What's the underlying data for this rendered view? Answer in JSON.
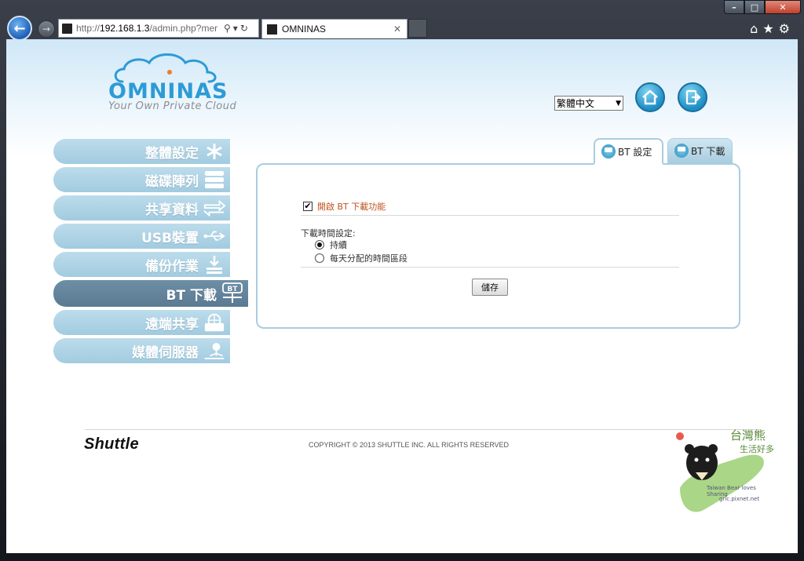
{
  "browser": {
    "url_prefix": "http://",
    "url_host": "192.168.1.3",
    "url_rest": "/admin.php?mer",
    "tab_title": "OMNINAS",
    "window_controls": [
      "minimize-icon",
      "maximize-icon",
      "close-icon"
    ]
  },
  "header": {
    "logo_text": "OMNINAS",
    "logo_sub": "Your Own Private Cloud",
    "language": "繁體中文"
  },
  "sidebar": {
    "items": [
      {
        "label": "整體設定",
        "icon": "asterisk-icon"
      },
      {
        "label": "磁碟陣列",
        "icon": "disk-stack-icon"
      },
      {
        "label": "共享資料",
        "icon": "exchange-arrows-icon"
      },
      {
        "label": "USB裝置",
        "icon": "usb-icon"
      },
      {
        "label": "備份作業",
        "icon": "download-tray-icon"
      },
      {
        "label": "BT 下載",
        "icon": "bt-download-icon",
        "badge": "BT",
        "active": true
      },
      {
        "label": "遠端共享",
        "icon": "globe-folder-icon"
      },
      {
        "label": "媒體伺服器",
        "icon": "media-server-icon"
      }
    ]
  },
  "panel": {
    "tabs": [
      {
        "label": "BT 設定",
        "active": true
      },
      {
        "label": "BT 下載",
        "active": false
      }
    ],
    "enable_label": "開啟 BT 下載功能",
    "enable_checked": true,
    "schedule_label": "下載時間設定:",
    "radio_options": [
      {
        "label": "持續",
        "selected": true
      },
      {
        "label": "每天分配的時間區段",
        "selected": false
      }
    ],
    "save_label": "儲存"
  },
  "footer": {
    "brand": "Shuttle",
    "copyright": "COPYRIGHT © 2013 SHUTTLE INC. ALL RIGHTS RESERVED"
  },
  "watermark": {
    "line1": "台灣熊",
    "line2": "生活好多",
    "line3": "Taiwan Bear loves Sharing",
    "line4": "gric.pixnet.net"
  },
  "colors": {
    "accent_blue": "#2d9bd6",
    "menu_bg": "#a2cbe0",
    "menu_active_bg": "#5a7a92",
    "enable_text": "#c0531f"
  }
}
